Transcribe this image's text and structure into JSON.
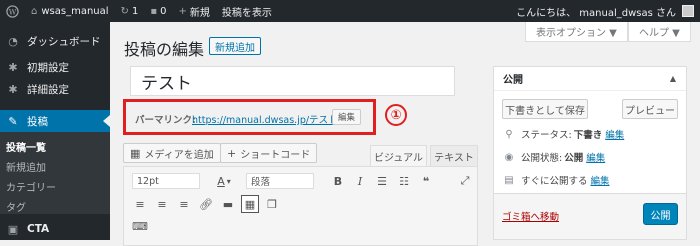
{
  "adminbar": {
    "site_name": "wsas_manual",
    "updates_count": "1",
    "comments_count": "0",
    "new_label": "新規",
    "view_post_label": "投稿を表示",
    "greeting": "こんにちは、 manual_dwsas さん"
  },
  "sidebar": {
    "items": [
      {
        "label": "ダッシュボード",
        "icon": "dashboard-icon"
      },
      {
        "label": "初期設定",
        "icon": "gear-icon"
      },
      {
        "label": "詳細設定",
        "icon": "gear-icon"
      },
      {
        "label": "投稿",
        "icon": "pin-icon"
      }
    ],
    "submenu": [
      "投稿一覧",
      "新規追加",
      "カテゴリー",
      "タグ"
    ],
    "cta": "CTA"
  },
  "screen_options": "表示オプション ▼",
  "help": "ヘルプ ▼",
  "page_title": "投稿の編集",
  "add_new": "新規追加",
  "post_title": "テスト",
  "permalink": {
    "label": "パーマリンク:",
    "url": "https://manual.dwsas.jp/テスト/",
    "edit": "編集"
  },
  "annotation_number": "①",
  "editor": {
    "add_media": "メディアを追加",
    "shortcode": "ショートコード",
    "tab_visual": "ビジュアル",
    "tab_text": "テキスト",
    "font_size": "12pt",
    "format": "段落"
  },
  "publish": {
    "title": "公開",
    "save_draft": "下書きとして保存",
    "preview": "プレビュー",
    "status_label": "ステータス:",
    "status_value": "下書き",
    "visibility_label": "公開状態:",
    "visibility_value": "公開",
    "schedule_label": "すぐに公開する",
    "edit": "編集",
    "trash": "ゴミ箱へ移動",
    "publish_button": "公開"
  },
  "colors": {
    "accent": "#0073aa",
    "adminbar_bg": "#23282d",
    "highlight_red": "#e02020",
    "publish_button": "#0085ba"
  }
}
